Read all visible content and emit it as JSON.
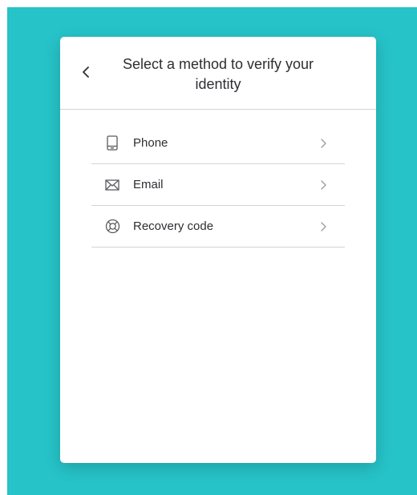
{
  "header": {
    "title": "Select a method to verify your identity",
    "back_icon": "chevron-left-icon"
  },
  "methods": [
    {
      "label": "Phone",
      "icon": "phone-icon"
    },
    {
      "label": "Email",
      "icon": "mail-icon"
    },
    {
      "label": "Recovery code",
      "icon": "lifebuoy-icon"
    }
  ],
  "colors": {
    "backdrop": "#26c3c8",
    "card": "#ffffff",
    "text": "#2e2e33",
    "divider": "#d4d4d4",
    "icon": "#5a5a60",
    "chevron": "#9b9ba0"
  }
}
